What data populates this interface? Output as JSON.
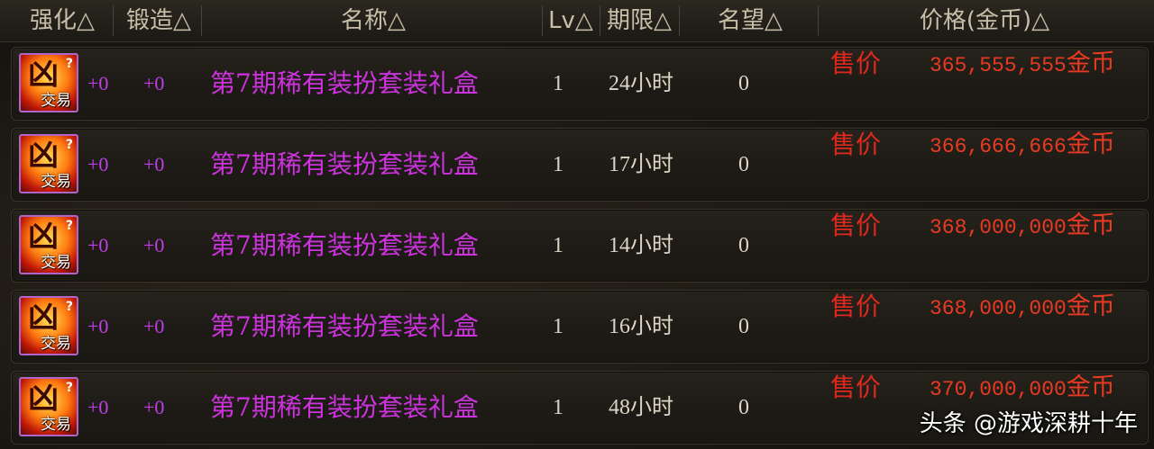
{
  "header": {
    "columns": [
      {
        "label": "强化△"
      },
      {
        "label": "锻造△"
      },
      {
        "label": "名称△"
      },
      {
        "label": "Lv△"
      },
      {
        "label": "期限△"
      },
      {
        "label": "名望△"
      },
      {
        "label": "价格(金币)△"
      }
    ]
  },
  "rows": [
    {
      "icon_label": "交易",
      "icon_mark": "?",
      "enhance": "+0",
      "forge": "+0",
      "name": "第7期稀有装扮套装礼盒",
      "lv": "1",
      "period": "24小时",
      "fame": "0",
      "sell_label": "售价",
      "price": "365,555,555",
      "unit": "金币"
    },
    {
      "icon_label": "交易",
      "icon_mark": "?",
      "enhance": "+0",
      "forge": "+0",
      "name": "第7期稀有装扮套装礼盒",
      "lv": "1",
      "period": "17小时",
      "fame": "0",
      "sell_label": "售价",
      "price": "366,666,666",
      "unit": "金币"
    },
    {
      "icon_label": "交易",
      "icon_mark": "?",
      "enhance": "+0",
      "forge": "+0",
      "name": "第7期稀有装扮套装礼盒",
      "lv": "1",
      "period": "14小时",
      "fame": "0",
      "sell_label": "售价",
      "price": "368,000,000",
      "unit": "金币"
    },
    {
      "icon_label": "交易",
      "icon_mark": "?",
      "enhance": "+0",
      "forge": "+0",
      "name": "第7期稀有装扮套装礼盒",
      "lv": "1",
      "period": "16小时",
      "fame": "0",
      "sell_label": "售价",
      "price": "368,000,000",
      "unit": "金币"
    },
    {
      "icon_label": "交易",
      "icon_mark": "?",
      "enhance": "+0",
      "forge": "+0",
      "name": "第7期稀有装扮套装礼盒",
      "lv": "1",
      "period": "48小时",
      "fame": "0",
      "sell_label": "售价",
      "price": "370,000,000",
      "unit": "金币"
    }
  ],
  "watermark": "头条 @游戏深耕十年",
  "colors": {
    "name": "#cc33dd",
    "price": "#e83a22",
    "plus": "#c040e8",
    "item_border": "#b066c8"
  }
}
